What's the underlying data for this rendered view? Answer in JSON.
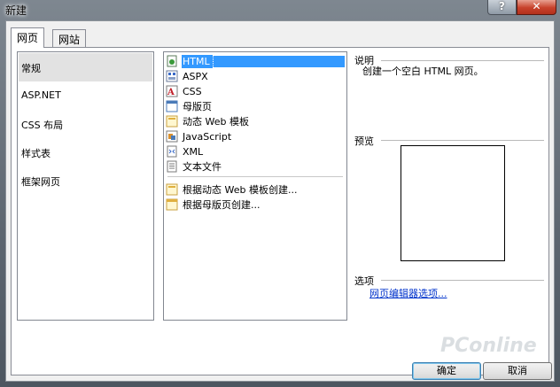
{
  "window": {
    "title": "新建",
    "help_glyph": "?",
    "close_glyph": "✕"
  },
  "tabs": [
    {
      "label": "网页",
      "active": true
    },
    {
      "label": "网站",
      "active": false
    }
  ],
  "categories": [
    {
      "label": "常规",
      "selected": true
    },
    {
      "label": "ASP.NET",
      "selected": false
    },
    {
      "label": "CSS 布局",
      "selected": false
    },
    {
      "label": "样式表",
      "selected": false
    },
    {
      "label": "框架网页",
      "selected": false
    }
  ],
  "templates": [
    {
      "label": "HTML",
      "icon": "html-page-icon",
      "selected": true
    },
    {
      "label": "ASPX",
      "icon": "aspx-page-icon",
      "selected": false
    },
    {
      "label": "CSS",
      "icon": "css-file-icon",
      "selected": false
    },
    {
      "label": "母版页",
      "icon": "master-page-icon",
      "selected": false
    },
    {
      "label": "动态 Web 模板",
      "icon": "dynamic-template-icon",
      "selected": false
    },
    {
      "label": "JavaScript",
      "icon": "javascript-file-icon",
      "selected": false
    },
    {
      "label": "XML",
      "icon": "xml-file-icon",
      "selected": false
    },
    {
      "label": "文本文件",
      "icon": "text-file-icon",
      "selected": false
    }
  ],
  "create_from": [
    {
      "label": "根据动态 Web 模板创建...",
      "icon": "dynamic-template-icon"
    },
    {
      "label": "根据母版页创建...",
      "icon": "master-page-icon"
    }
  ],
  "description": {
    "title": "说明",
    "text": "创建一个空白 HTML 网页。"
  },
  "preview": {
    "title": "预览"
  },
  "options": {
    "title": "选项",
    "link": "网页编辑器选项..."
  },
  "buttons": {
    "ok": "确定",
    "cancel": "取消"
  },
  "watermark": "PConline"
}
